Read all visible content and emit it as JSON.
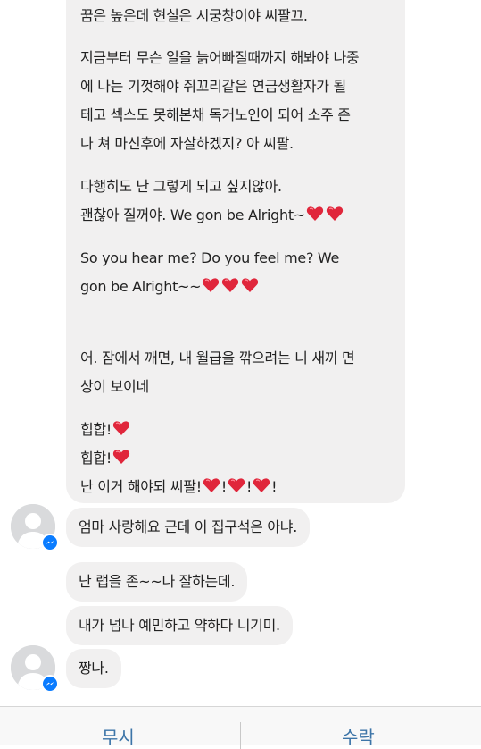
{
  "colors": {
    "bubble_bg": "#f1f0f0",
    "heart": "#e0263b",
    "action_text": "#3d75a8",
    "messenger_badge": "#0a7cff"
  },
  "big_bubble": {
    "p1": "꿈은 높은데 현실은 시궁창이야 씨팔끄.",
    "p2_l1": "지금부터 무슨 일을 늙어빠질때까지 해봐야 나중",
    "p2_l2": "에 나는 기껏해야 쥐꼬리같은 연금생활자가 될",
    "p2_l3": "테고 섹스도 못해본채 독거노인이 되어 소주 존",
    "p2_l4": "나 쳐 마신후에 자살하겠지? 아 씨팔.",
    "p3_l1": "다행히도 난 그렇게 되고 싶지않아.",
    "p3_l2": "괜찮아 질꺼야. We gon be Alright~",
    "p4_l1": "So you hear me? Do you feel me? We",
    "p4_l2": "gon be Alright~~",
    "p5_l1": "어. 잠에서 깨면, 내 월급을 깎으려는 니 새끼 면",
    "p5_l2": "상이 보이네",
    "p6_l1": "힙합!",
    "p6_l2": "힙합!",
    "p6_l3_a": "난 이거 해야되 씨팔!",
    "p6_l3_b": "!",
    "p6_l3_c": "!",
    "p6_l3_d": "!"
  },
  "messages": [
    {
      "text": "엄마 사랑해요 근데 이 집구석은 아냐."
    },
    {
      "text": "난 랩을 존~~나 잘하는데."
    },
    {
      "text": "내가 넘나 예민하고 약하다 니기미."
    },
    {
      "text": "짱나."
    }
  ],
  "actions": {
    "ignore_label": "무시",
    "accept_label": "수락"
  }
}
